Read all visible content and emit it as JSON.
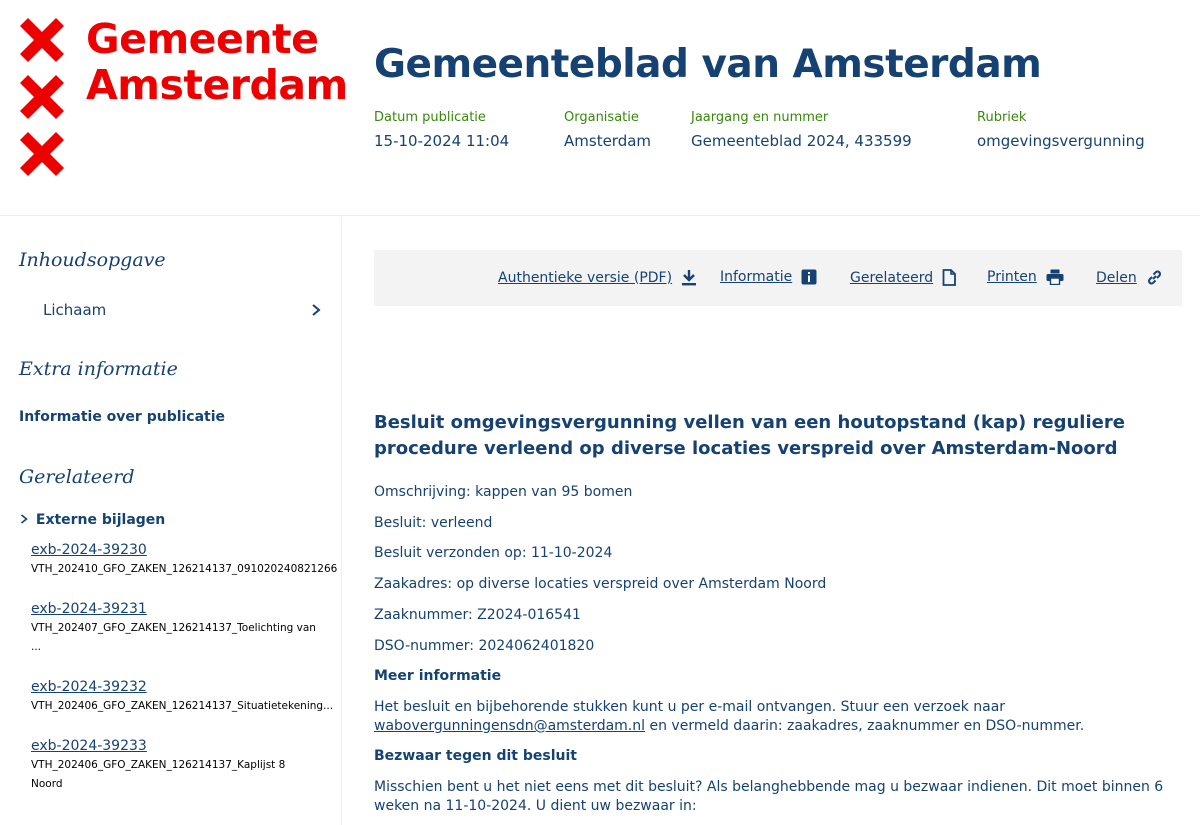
{
  "logo": {
    "line1": "Gemeente",
    "line2": "Amsterdam",
    "color": "#ec0000"
  },
  "header": {
    "title": "Gemeenteblad van Amsterdam",
    "meta": [
      {
        "label": "Datum publicatie",
        "value": "15-10-2024 11:04"
      },
      {
        "label": "Organisatie",
        "value": "Amsterdam"
      },
      {
        "label": "Jaargang en nummer",
        "value": "Gemeenteblad 2024, 433599"
      },
      {
        "label": "Rubriek",
        "value": "omgevingsvergunning"
      }
    ]
  },
  "sidebar": {
    "toc_heading": "Inhoudsopgave",
    "toc_item": "Lichaam",
    "extra_heading": "Extra informatie",
    "extra_link": "Informatie over publicatie",
    "related_heading": "Gerelateerd",
    "external_heading": "Externe bijlagen",
    "attachments": [
      {
        "id": "exb-2024-39230",
        "desc1": "VTH_202410_GFO_ZAKEN_126214137_091020240821266",
        "desc2": ""
      },
      {
        "id": "exb-2024-39231",
        "desc1": "VTH_202407_GFO_ZAKEN_126214137_Toelichting van",
        "desc2": "..."
      },
      {
        "id": "exb-2024-39232",
        "desc1": "VTH_202406_GFO_ZAKEN_126214137_Situatietekening...",
        "desc2": ""
      },
      {
        "id": "exb-2024-39233",
        "desc1": "VTH_202406_GFO_ZAKEN_126214137_Kaplijst 8",
        "desc2": "Noord"
      }
    ]
  },
  "toolbar": {
    "pdf": "Authentieke versie (PDF)",
    "info": "Informatie",
    "related": "Gerelateerd",
    "print": "Printen",
    "share": "Delen"
  },
  "content": {
    "title": "Besluit omgevingsvergunning vellen van een houtopstand (kap) reguliere procedure verleend op diverse locaties verspreid over Amsterdam-Noord",
    "lines": [
      "Omschrijving: kappen van 95 bomen",
      "Besluit: verleend",
      "Besluit verzonden op: 11-10-2024",
      "Zaakadres: op diverse locaties verspreid over Amsterdam Noord",
      "Zaaknummer: Z2024-016541",
      "DSO-nummer: 2024062401820"
    ],
    "meer_heading": "Meer informatie",
    "meer_text1": "Het besluit en bijbehorende stukken kunt u per e-mail ontvangen. Stuur een verzoek naar",
    "meer_email": "wabovergunningensdn@amsterdam.nl",
    "meer_text2": "en vermeld daarin: zaakadres, zaaknummer en DSO-nummer.",
    "bezwaar_heading": "Bezwaar tegen dit besluit",
    "bezwaar_text": "Misschien bent u het niet eens met dit besluit? Als belanghebbende mag u bezwaar indienen. Dit moet binnen 6 weken na 11-10-2024. U dient uw bezwaar in:"
  },
  "colors": {
    "primary": "#154273",
    "meta_label": "#39870c",
    "toolbar_bg": "#f3f3f3"
  }
}
